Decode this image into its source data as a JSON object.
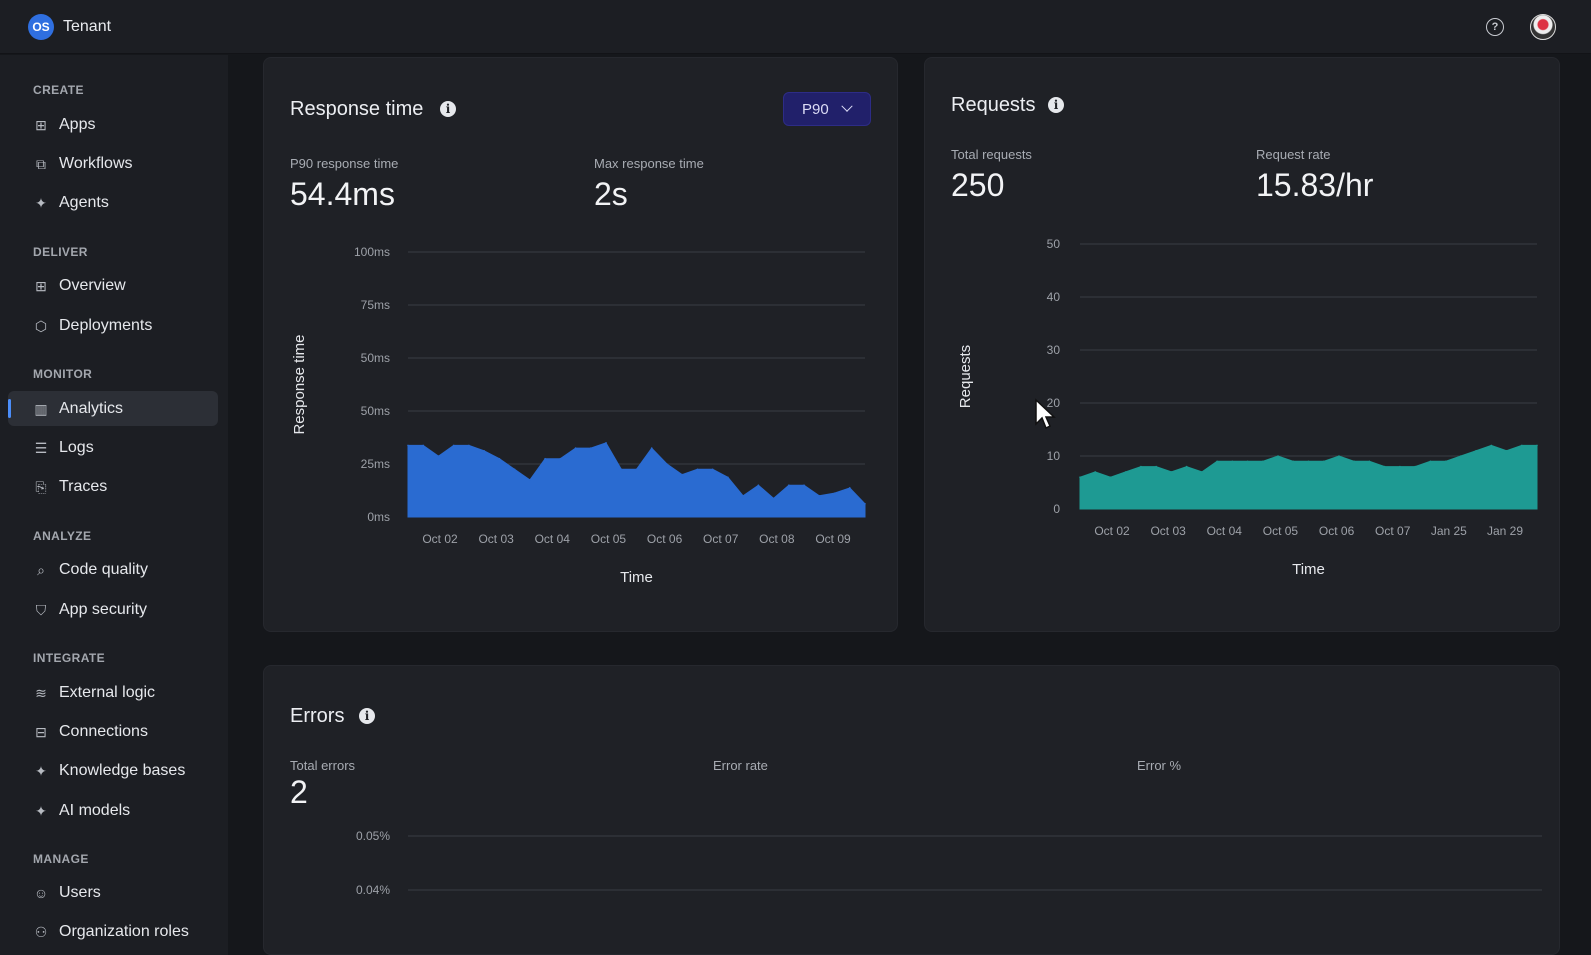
{
  "app": {
    "logo": "OS",
    "tenant": "Tenant"
  },
  "header": {
    "help_icon": "?",
    "avatar_icon": "user-avatar"
  },
  "sidebar": {
    "sections": [
      {
        "label": "CREATE",
        "items": [
          {
            "label": "Apps",
            "icon": "apps-icon"
          },
          {
            "label": "Workflows",
            "icon": "workflows-icon"
          },
          {
            "label": "Agents",
            "icon": "agents-icon"
          }
        ]
      },
      {
        "label": "DELIVER",
        "items": [
          {
            "label": "Overview",
            "icon": "overview-icon"
          },
          {
            "label": "Deployments",
            "icon": "deployments-icon"
          }
        ]
      },
      {
        "label": "MONITOR",
        "items": [
          {
            "label": "Analytics",
            "icon": "analytics-icon",
            "active": true
          },
          {
            "label": "Logs",
            "icon": "logs-icon"
          },
          {
            "label": "Traces",
            "icon": "traces-icon"
          }
        ]
      },
      {
        "label": "ANALYZE",
        "items": [
          {
            "label": "Code quality",
            "icon": "code-quality-icon"
          },
          {
            "label": "App security",
            "icon": "shield-icon"
          }
        ]
      },
      {
        "label": "INTEGRATE",
        "items": [
          {
            "label": "External logic",
            "icon": "layers-icon"
          },
          {
            "label": "Connections",
            "icon": "connections-icon"
          },
          {
            "label": "Knowledge bases",
            "icon": "sparkle-icon"
          },
          {
            "label": "AI models",
            "icon": "sparkle-icon"
          }
        ]
      },
      {
        "label": "MANAGE",
        "items": [
          {
            "label": "Users",
            "icon": "users-icon"
          },
          {
            "label": "Organization roles",
            "icon": "org-roles-icon"
          }
        ]
      }
    ]
  },
  "response_card": {
    "title": "Response time",
    "selector": "P90",
    "stats": [
      {
        "label": "P90 response time",
        "value": "54.4ms"
      },
      {
        "label": "Max response time",
        "value": "2s"
      }
    ]
  },
  "requests_card": {
    "title": "Requests",
    "stats": [
      {
        "label": "Total requests",
        "value": "250"
      },
      {
        "label": "Request rate",
        "value": "15.83/hr"
      }
    ]
  },
  "errors_card": {
    "title": "Errors",
    "stats": [
      {
        "label": "Total errors",
        "value": "2"
      },
      {
        "label": "Error rate",
        "value": ""
      },
      {
        "label": "Error %",
        "value": ""
      }
    ]
  },
  "chart_data": [
    {
      "type": "area",
      "title": "Response time",
      "xlabel": "Time",
      "ylabel": "Response time",
      "y_tick_labels": [
        "0ms",
        "25ms",
        "50ms",
        "50ms",
        "75ms",
        "100ms"
      ],
      "ylim": [
        0,
        100
      ],
      "x_tick_labels": [
        "Oct 02",
        "Oct 03",
        "Oct 04",
        "Oct 05",
        "Oct 06",
        "Oct 07",
        "Oct 08",
        "Oct 09"
      ],
      "color": "#2a6bd1",
      "values": [
        27,
        27,
        23,
        27,
        27,
        25,
        22,
        18,
        14,
        22,
        22,
        26,
        26,
        28,
        18,
        18,
        26,
        20,
        16,
        18,
        18,
        15,
        8,
        12,
        7,
        12,
        12,
        8,
        9,
        11,
        5
      ],
      "grid": true
    },
    {
      "type": "area",
      "title": "Requests",
      "xlabel": "Time",
      "ylabel": "Requests",
      "y_tick_labels": [
        "0",
        "10",
        "20",
        "30",
        "40",
        "50"
      ],
      "ylim": [
        0,
        50
      ],
      "x_tick_labels": [
        "Oct 02",
        "Oct 03",
        "Oct 04",
        "Oct 05",
        "Oct 06",
        "Oct 07",
        "Jan 25",
        "Jan 29"
      ],
      "color": "#1e9a93",
      "values": [
        6,
        7,
        6,
        7,
        8,
        8,
        7,
        8,
        7,
        9,
        9,
        9,
        9,
        10,
        9,
        9,
        9,
        10,
        9,
        9,
        8,
        8,
        8,
        9,
        9,
        10,
        11,
        12,
        11,
        12,
        12
      ],
      "grid": true
    },
    {
      "type": "area",
      "title": "Errors",
      "xlabel": "",
      "ylabel": "",
      "y_tick_labels": [
        "0.04%",
        "0.05%"
      ],
      "values": [],
      "grid": true
    }
  ]
}
